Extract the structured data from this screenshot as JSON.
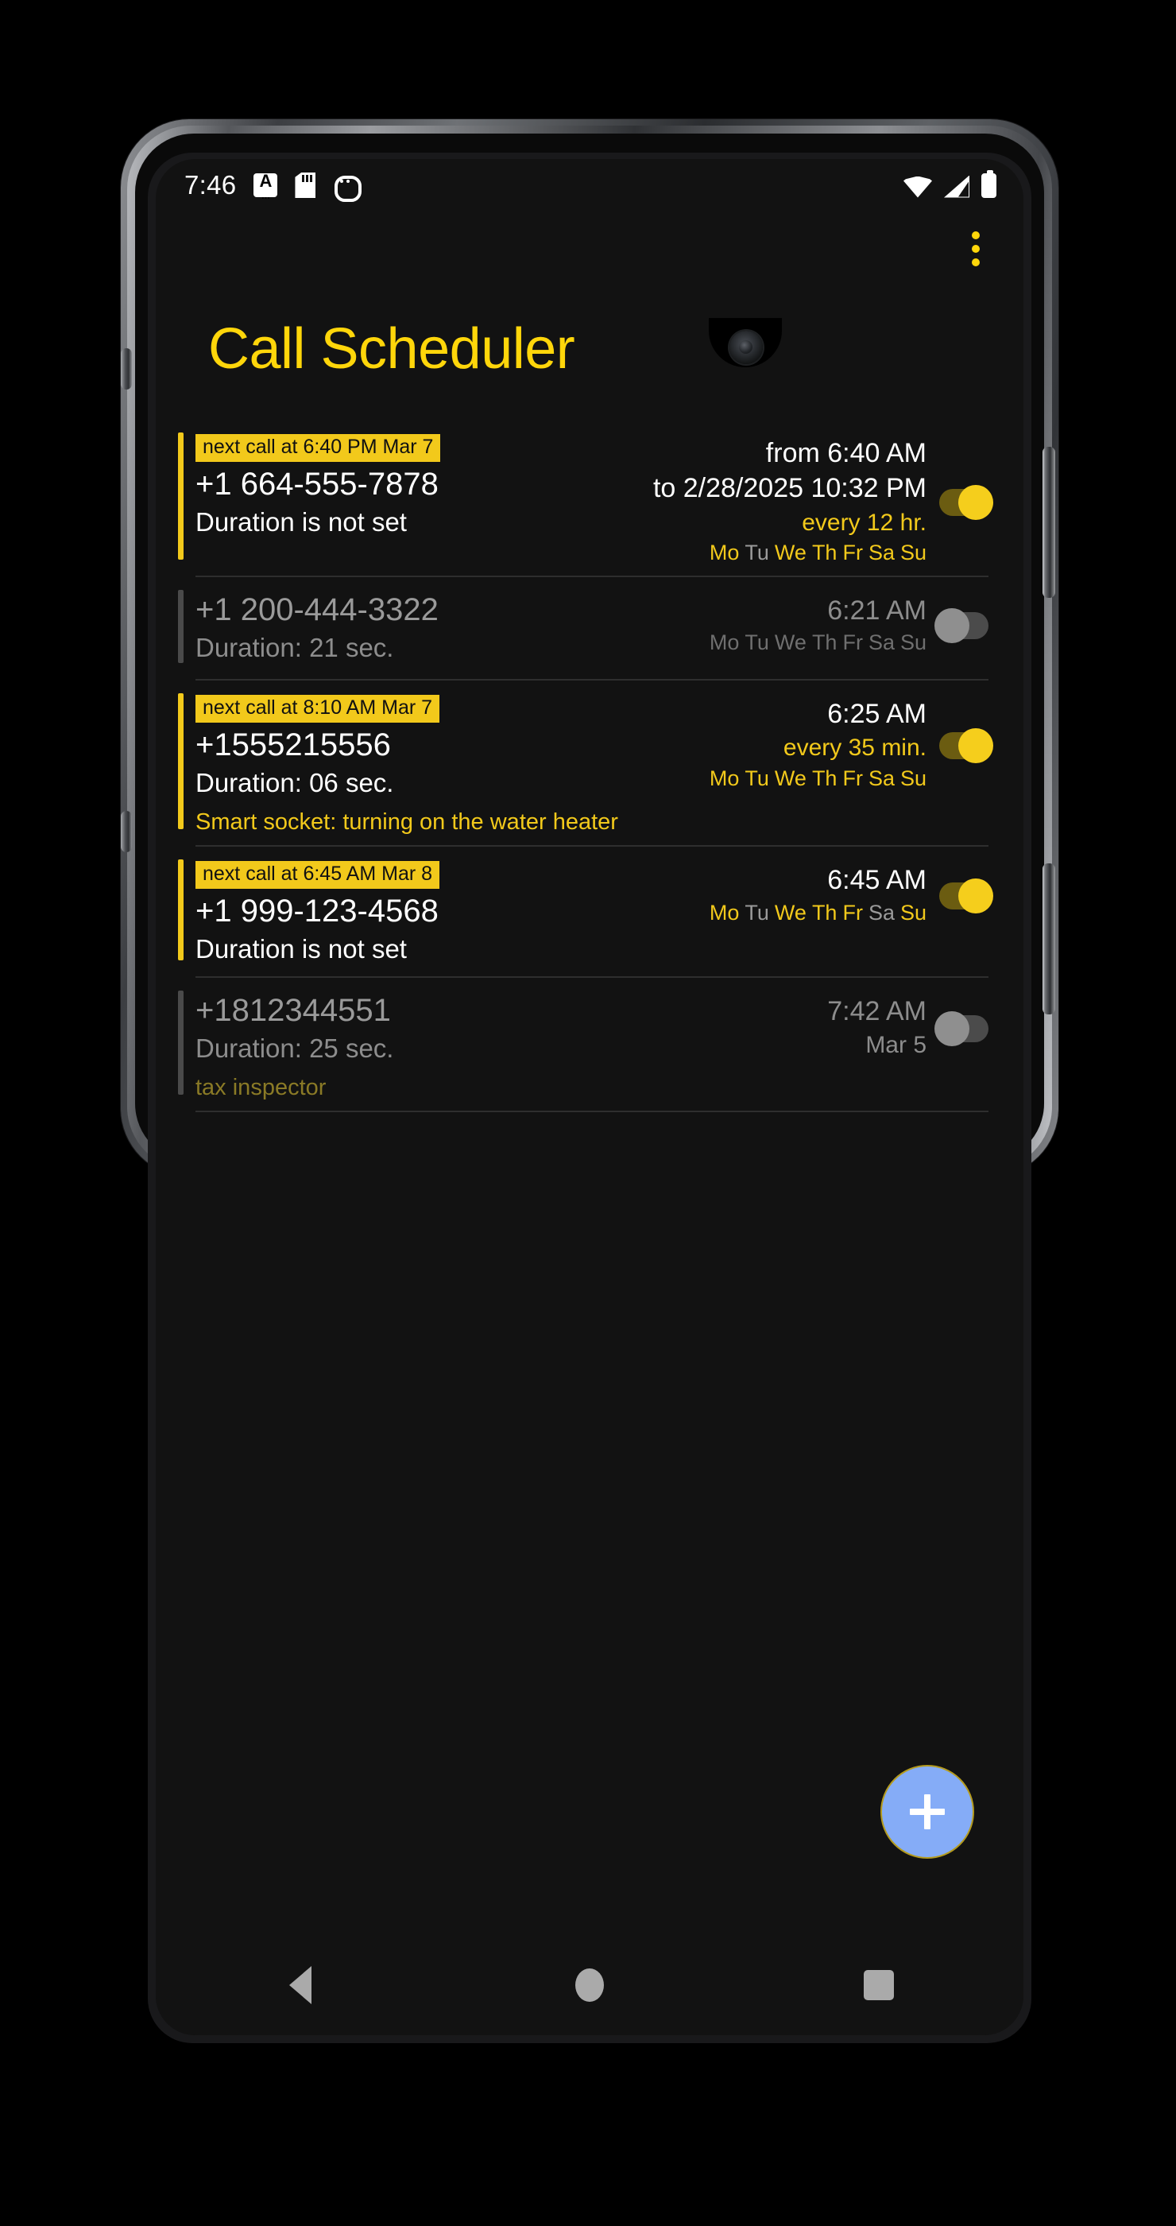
{
  "status_bar": {
    "time": "7:46",
    "left_icons": [
      "abc-autocorrect-icon",
      "sd-card-icon",
      "android-debug-icon"
    ],
    "right_icons": [
      "wifi-icon",
      "cellular-signal-icon",
      "battery-icon"
    ]
  },
  "app": {
    "title": "Call Scheduler",
    "accent_color": "#F2C91B",
    "background_color": "#121212",
    "overflow_menu": "overflow-menu-icon",
    "fab": {
      "label": "+",
      "name": "add-schedule-fab",
      "color": "#85ACF7"
    }
  },
  "schedules": [
    {
      "enabled": true,
      "badge": "next call at 6:40 PM Mar 7",
      "number": "+1 664-555-7878",
      "duration": "Duration is not set",
      "note": "",
      "time_from": "from 6:40 AM",
      "time_to": "to 2/28/2025 10:32 PM",
      "repeat": "every 12 hr.",
      "date": "",
      "days": [
        {
          "label": "Mo",
          "active": true
        },
        {
          "label": "Tu",
          "active": false
        },
        {
          "label": "We",
          "active": true
        },
        {
          "label": "Th",
          "active": true
        },
        {
          "label": "Fr",
          "active": true
        },
        {
          "label": "Sa",
          "active": true
        },
        {
          "label": "Su",
          "active": true
        }
      ]
    },
    {
      "enabled": false,
      "badge": "",
      "number": "+1 200-444-3322",
      "duration": "Duration: 21 sec.",
      "note": "",
      "time_from": "6:21 AM",
      "time_to": "",
      "repeat": "",
      "date": "",
      "days": [
        {
          "label": "Mo",
          "active": true
        },
        {
          "label": "Tu",
          "active": true
        },
        {
          "label": "We",
          "active": true
        },
        {
          "label": "Th",
          "active": true
        },
        {
          "label": "Fr",
          "active": true
        },
        {
          "label": "Sa",
          "active": true
        },
        {
          "label": "Su",
          "active": true
        }
      ]
    },
    {
      "enabled": true,
      "badge": "next call at 8:10 AM Mar 7",
      "number": "+1555215556",
      "duration": "Duration: 06 sec.",
      "note": "Smart socket: turning on the water heater",
      "time_from": "6:25 AM",
      "time_to": "",
      "repeat": "every 35 min.",
      "date": "",
      "days": [
        {
          "label": "Mo",
          "active": true
        },
        {
          "label": "Tu",
          "active": true
        },
        {
          "label": "We",
          "active": true
        },
        {
          "label": "Th",
          "active": true
        },
        {
          "label": "Fr",
          "active": true
        },
        {
          "label": "Sa",
          "active": true
        },
        {
          "label": "Su",
          "active": true
        }
      ]
    },
    {
      "enabled": true,
      "badge": "next call at 6:45 AM Mar 8",
      "number": "+1 999-123-4568",
      "duration": "Duration is not set",
      "note": "",
      "time_from": "6:45 AM",
      "time_to": "",
      "repeat": "",
      "date": "",
      "days": [
        {
          "label": "Mo",
          "active": true
        },
        {
          "label": "Tu",
          "active": false
        },
        {
          "label": "We",
          "active": true
        },
        {
          "label": "Th",
          "active": true
        },
        {
          "label": "Fr",
          "active": true
        },
        {
          "label": "Sa",
          "active": false
        },
        {
          "label": "Su",
          "active": true
        }
      ]
    },
    {
      "enabled": false,
      "badge": "",
      "number": "+1812344551",
      "duration": "Duration: 25 sec.",
      "note": "tax inspector",
      "time_from": "7:42 AM",
      "time_to": "",
      "repeat": "",
      "date": "Mar 5",
      "days": []
    }
  ],
  "nav_bar": {
    "back": "back-nav-icon",
    "home": "home-nav-icon",
    "recents": "recents-nav-icon"
  }
}
